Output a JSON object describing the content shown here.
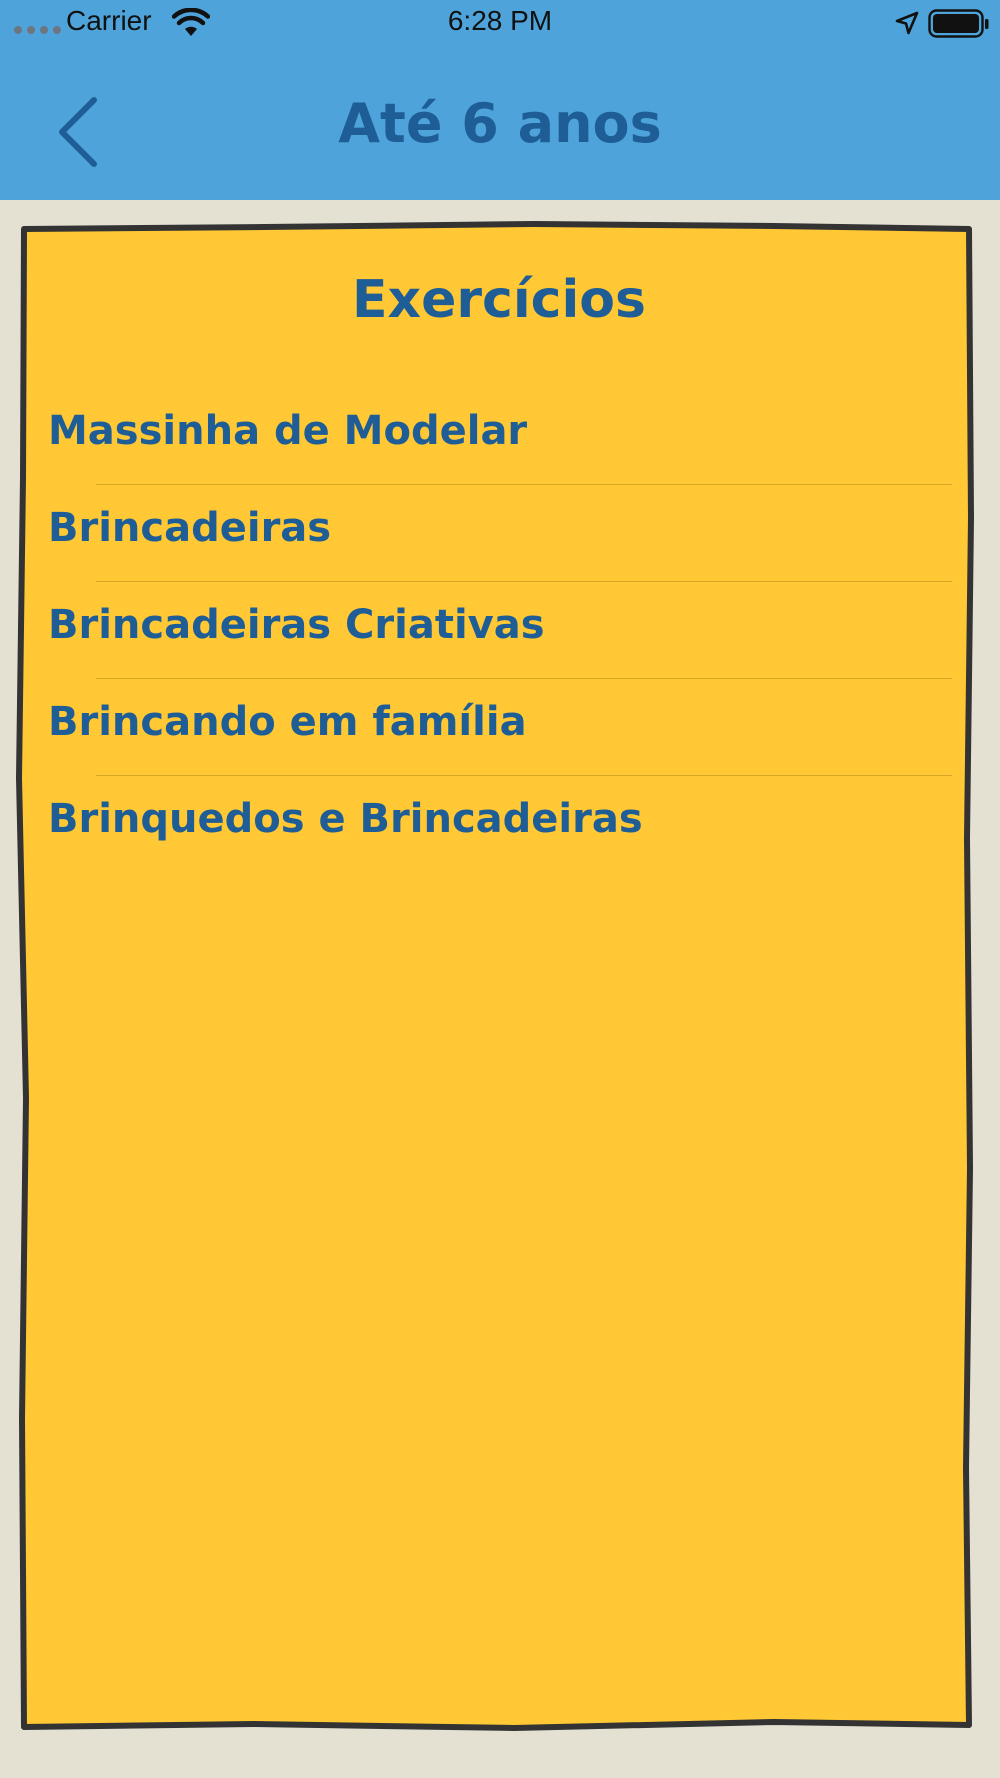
{
  "status_bar": {
    "carrier": "Carrier",
    "time": "6:28 PM",
    "icons": [
      "signal-dots-icon",
      "wifi-icon",
      "location-arrow-icon",
      "battery-icon"
    ]
  },
  "nav": {
    "back_icon": "chevron-left-icon",
    "title": "Até 6 anos"
  },
  "content": {
    "title": "Exercícios",
    "items": [
      {
        "label": "Massinha de Modelar"
      },
      {
        "label": "Brincadeiras"
      },
      {
        "label": "Brincadeiras Criativas"
      },
      {
        "label": "Brincando em família"
      },
      {
        "label": "Brinquedos e Brincadeiras"
      }
    ]
  },
  "colors": {
    "nav_background": "#4ea4da",
    "nav_title": "#1e5d96",
    "page_background": "#e4e1d3",
    "card_background": "#ffc834",
    "card_border": "#333333",
    "text": "#1e5d96"
  }
}
